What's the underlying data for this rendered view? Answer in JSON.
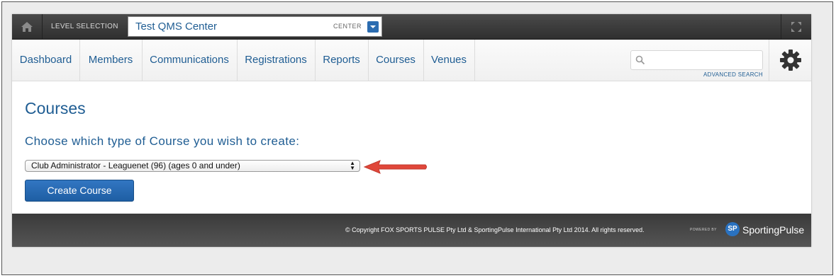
{
  "topbar": {
    "level_label": "LEVEL SELECTION",
    "level_name": "Test QMS Center",
    "level_type": "CENTER",
    "icons": [
      "home-icon",
      "dropdown-icon",
      "expand-icon"
    ]
  },
  "nav": {
    "items": [
      {
        "label": "Dashboard"
      },
      {
        "label": "Members"
      },
      {
        "label": "Communications"
      },
      {
        "label": "Registrations"
      },
      {
        "label": "Reports"
      },
      {
        "label": "Courses"
      },
      {
        "label": "Venues"
      }
    ],
    "search_placeholder": "",
    "advanced_search": "ADVANCED SEARCH",
    "settings_icon": "gear-icon"
  },
  "main": {
    "title": "Courses",
    "instruction": "Choose which type of Course you wish to create:",
    "select_value": "Club Administrator - Leaguenet (96) (ages 0 and under)",
    "create_button": "Create Course"
  },
  "footer": {
    "copyright": "©  Copyright FOX SPORTS PULSE Pty Ltd & SportingPulse International Pty Ltd  2014.  All rights reserved.",
    "powered_by": "POWERED BY",
    "logo_mark": "SP",
    "brand": "SportingPulse"
  },
  "colors": {
    "accent": "#1f5d93",
    "button": "#2469b4",
    "arrow": "#e0473a"
  }
}
